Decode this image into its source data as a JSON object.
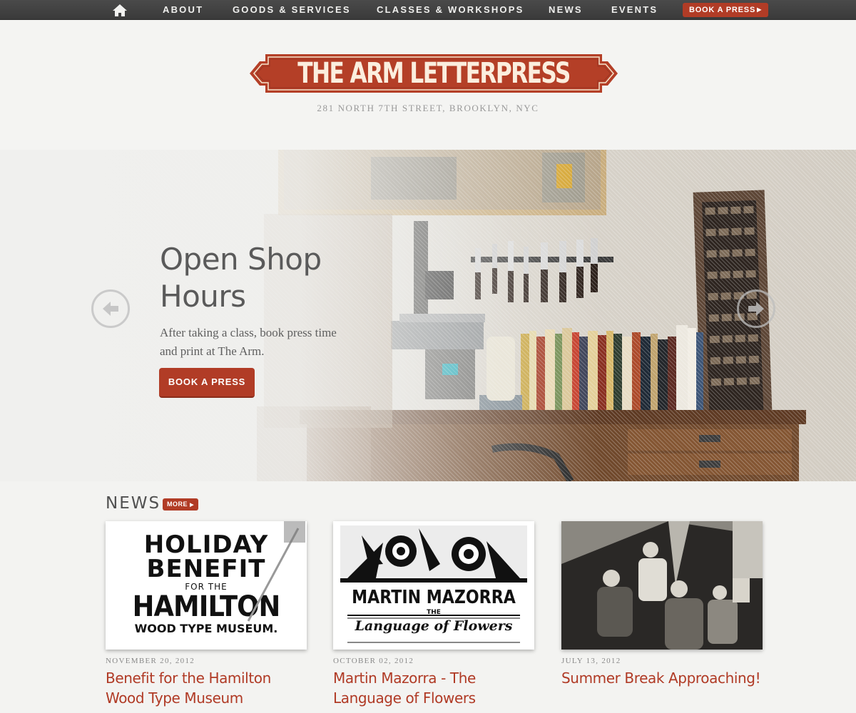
{
  "nav": {
    "home_icon": "home-icon",
    "links": [
      "About",
      "Goods & Services",
      "Classes & Workshops",
      "News",
      "Events"
    ],
    "book_label": "BOOK A PRESS"
  },
  "header": {
    "logo_text": "THE ARM LETTERPRESS",
    "address": "281 North 7th Street, Brooklyn, NYC"
  },
  "hero": {
    "title": "Open Shop Hours",
    "text": "After taking a class, book press time and print at The Arm.",
    "button_label": "BOOK A PRESS",
    "prev_icon": "arrow-left-icon",
    "next_icon": "arrow-right-icon"
  },
  "news": {
    "heading": "NEWS",
    "more_label": "MORE",
    "items": [
      {
        "date": "NOVEMBER 20, 2012",
        "headline": "Benefit for the Hamilton Wood Type Museum",
        "image_text": [
          "HOLIDAY",
          "BENEFIT",
          "FOR THE",
          "HAMILTON",
          "WOOD TYPE MUSEUM."
        ]
      },
      {
        "date": "OCTOBER 02, 2012",
        "headline": "Martin Mazorra - The Language of Flowers",
        "image_text": [
          "MARTIN MAZORRA",
          "THE",
          "Language of Flowers"
        ]
      },
      {
        "date": "JULY 13, 2012",
        "headline": "Summer Break Approaching!"
      }
    ]
  },
  "colors": {
    "accent": "#b13c26",
    "nav_bg": "#424242",
    "page_bg": "#f3f3f1",
    "headline": "#b03a25"
  }
}
